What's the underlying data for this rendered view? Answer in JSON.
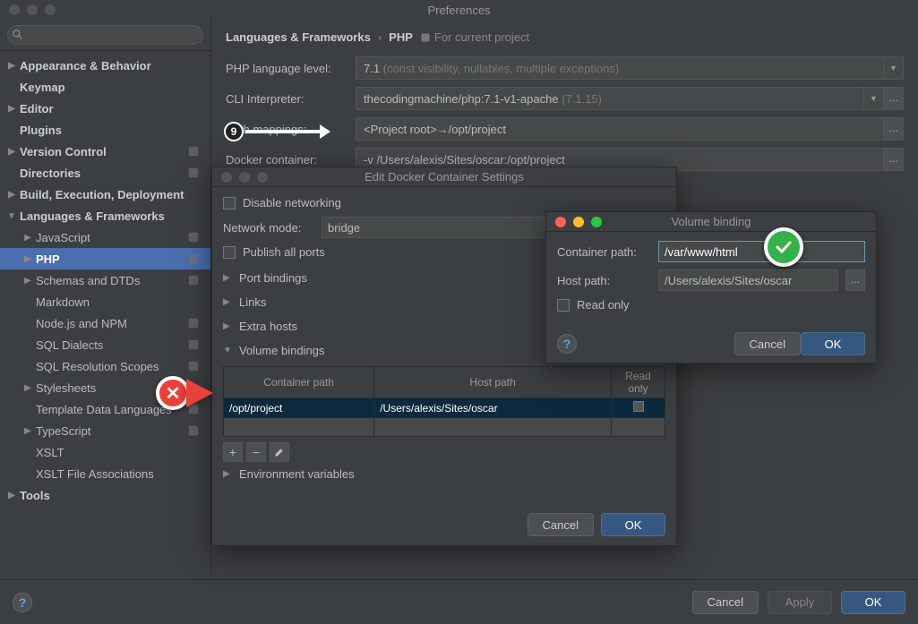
{
  "window": {
    "title": "Preferences"
  },
  "sidebar": {
    "search_placeholder": "",
    "items": [
      {
        "label": "Appearance & Behavior",
        "indent": 0,
        "arrow": "▶",
        "bold": true
      },
      {
        "label": "Keymap",
        "indent": 0,
        "arrow": "",
        "bold": true
      },
      {
        "label": "Editor",
        "indent": 0,
        "arrow": "▶",
        "bold": true
      },
      {
        "label": "Plugins",
        "indent": 0,
        "arrow": "",
        "bold": true
      },
      {
        "label": "Version Control",
        "indent": 0,
        "arrow": "▶",
        "bold": true,
        "scope": true
      },
      {
        "label": "Directories",
        "indent": 0,
        "arrow": "",
        "bold": true,
        "scope": true
      },
      {
        "label": "Build, Execution, Deployment",
        "indent": 0,
        "arrow": "▶",
        "bold": true
      },
      {
        "label": "Languages & Frameworks",
        "indent": 0,
        "arrow": "▼",
        "bold": true
      },
      {
        "label": "JavaScript",
        "indent": 1,
        "arrow": "▶",
        "scope": true
      },
      {
        "label": "PHP",
        "indent": 1,
        "arrow": "▶",
        "bold": true,
        "selected": true,
        "scope": true
      },
      {
        "label": "Schemas and DTDs",
        "indent": 1,
        "arrow": "▶",
        "scope": true
      },
      {
        "label": "Markdown",
        "indent": 1,
        "arrow": ""
      },
      {
        "label": "Node.js and NPM",
        "indent": 1,
        "arrow": "",
        "scope": true
      },
      {
        "label": "SQL Dialects",
        "indent": 1,
        "arrow": "",
        "scope": true
      },
      {
        "label": "SQL Resolution Scopes",
        "indent": 1,
        "arrow": "",
        "scope": true
      },
      {
        "label": "Stylesheets",
        "indent": 1,
        "arrow": "▶"
      },
      {
        "label": "Template Data Languages",
        "indent": 1,
        "arrow": "",
        "scope": true
      },
      {
        "label": "TypeScript",
        "indent": 1,
        "arrow": "▶",
        "scope": true
      },
      {
        "label": "XSLT",
        "indent": 1,
        "arrow": ""
      },
      {
        "label": "XSLT File Associations",
        "indent": 1,
        "arrow": ""
      },
      {
        "label": "Tools",
        "indent": 0,
        "arrow": "▶",
        "bold": true
      }
    ]
  },
  "breadcrumb": {
    "a": "Languages & Frameworks",
    "b": "PHP",
    "scope": "For current project"
  },
  "form": {
    "lang_level_lbl": "PHP language level:",
    "lang_level_val": "7.1",
    "lang_level_hint": "(const visibility, nullables, multiple exceptions)",
    "cli_lbl": "CLI Interpreter:",
    "cli_val": "thecodingmachine/php:7.1-v1-apache",
    "cli_hint": "(7.1.15)",
    "path_lbl": "Path mappings:",
    "path_val": "<Project root>→/opt/project",
    "docker_lbl": "Docker container:",
    "docker_val": "-v /Users/alexis/Sites/oscar:/opt/project"
  },
  "dialog1": {
    "title": "Edit Docker Container Settings",
    "disable_net": "Disable networking",
    "net_mode_lbl": "Network mode:",
    "net_mode_val": "bridge",
    "publish_all": "Publish all ports",
    "sections": {
      "port": "Port bindings",
      "links": "Links",
      "extra": "Extra hosts",
      "vol": "Volume bindings",
      "env": "Environment variables"
    },
    "table": {
      "col1": "Container path",
      "col2": "Host path",
      "col3": "Read only",
      "row1_c": "/opt/project",
      "row1_h": "/Users/alexis/Sites/oscar"
    },
    "cancel": "Cancel",
    "ok": "OK"
  },
  "dialog2": {
    "title": "Volume binding",
    "container_lbl": "Container path:",
    "container_val": "/var/www/html",
    "host_lbl": "Host path:",
    "host_val": "/Users/alexis/Sites/oscar",
    "readonly": "Read only",
    "cancel": "Cancel",
    "ok": "OK"
  },
  "footer": {
    "cancel": "Cancel",
    "apply": "Apply",
    "ok": "OK"
  },
  "annotations": {
    "step": "9"
  }
}
